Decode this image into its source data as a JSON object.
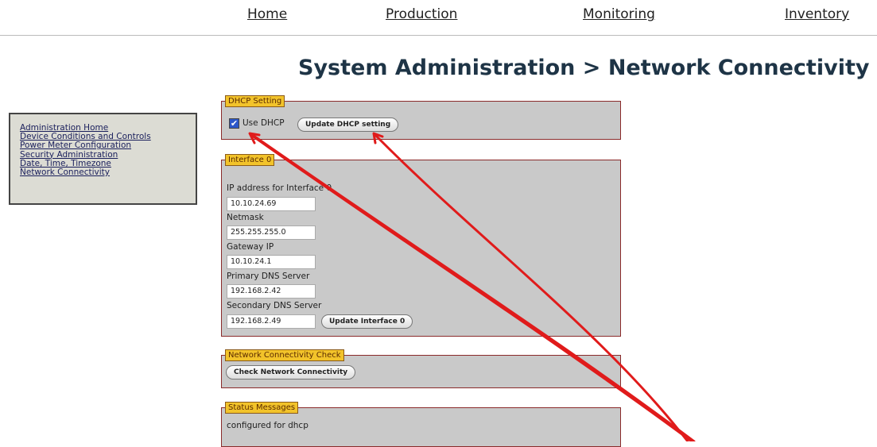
{
  "nav": {
    "items": [
      {
        "label": "Home"
      },
      {
        "label": "Production"
      },
      {
        "label": "Monitoring"
      },
      {
        "label": "Inventory"
      }
    ]
  },
  "page_title": "System Administration > Network Connectivity",
  "sidebar": {
    "items": [
      {
        "label": "Administration Home"
      },
      {
        "label": "Device Conditions and Controls"
      },
      {
        "label": "Power Meter Configuration"
      },
      {
        "label": "Security Administration"
      },
      {
        "label": "Date, Time, Timezone"
      },
      {
        "label": "Network Connectivity"
      }
    ]
  },
  "dhcp": {
    "legend": "DHCP Setting",
    "checkbox_label": "Use DHCP",
    "checked": true,
    "button": "Update DHCP setting"
  },
  "interface": {
    "legend": "Interface 0",
    "ip_label": "IP address for Interface 0",
    "ip_value": "10.10.24.69",
    "netmask_label": "Netmask",
    "netmask_value": "255.255.255.0",
    "gateway_label": "Gateway IP",
    "gateway_value": "10.10.24.1",
    "dns1_label": "Primary DNS Server",
    "dns1_value": "192.168.2.42",
    "dns2_label": "Secondary DNS Server",
    "dns2_value": "192.168.2.49",
    "button": "Update Interface 0"
  },
  "check": {
    "legend": "Network Connectivity Check",
    "button": "Check Network Connectivity"
  },
  "status": {
    "legend": "Status Messages",
    "message": "configured for dhcp"
  },
  "annotation": {
    "arrow_color": "#e01b1b"
  }
}
